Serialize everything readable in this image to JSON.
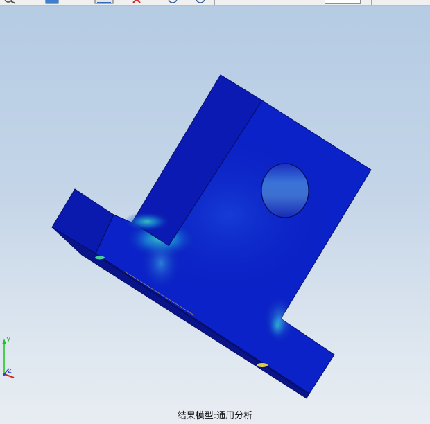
{
  "window": {
    "caption": "结果模型:通用分析"
  },
  "toolbar": {
    "icons": [
      "zoom-icon",
      "view-icon",
      "display-icon",
      "axis-icon",
      "rotate-icon",
      "rotate-icon"
    ]
  },
  "triad": {
    "y_label": "y",
    "z_label": "z"
  },
  "colors": {
    "background_top": "#b4cbe3",
    "background_bottom": "#e8edf2",
    "model_low": "#0a1db8",
    "model_mid": "#1a8fd6",
    "model_high": "#3fe0c0",
    "model_peak": "#f2e23a"
  }
}
